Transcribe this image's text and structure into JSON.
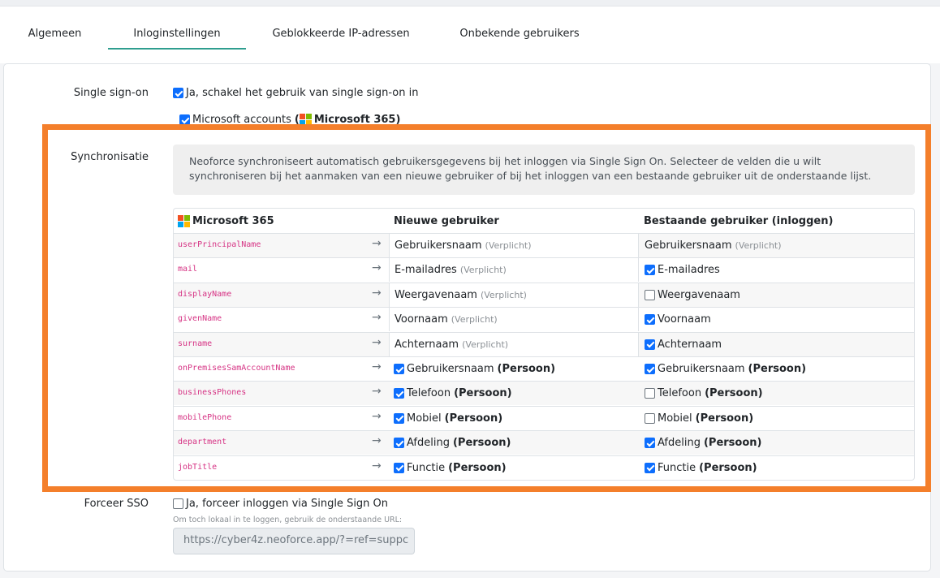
{
  "tabs": [
    {
      "label": "Algemeen",
      "active": false
    },
    {
      "label": "Inloginstellingen",
      "active": true
    },
    {
      "label": "Geblokkeerde IP-adressen",
      "active": false
    },
    {
      "label": "Onbekende gebruikers",
      "active": false
    }
  ],
  "sso": {
    "label": "Single sign-on",
    "enable_label": "Ja, schakel het gebruik van single sign-on in",
    "enabled": true,
    "microsoft_label": "Microsoft accounts",
    "microsoft_paren_open": "(",
    "microsoft_brand": "Microsoft 365",
    "microsoft_paren_close": ")",
    "microsoft_enabled": true
  },
  "sync": {
    "label": "Synchronisatie",
    "info": "Neoforce synchroniseert automatisch gebruikersgegevens bij het inloggen via Single Sign On. Selecteer de velden die u wilt synchroniseren bij het aanmaken van een nieuwe gebruiker of bij het inloggen van een bestaande gebruiker uit de onderstaande lijst.",
    "headers": {
      "source": "Microsoft 365",
      "new_user": "Nieuwe gebruiker",
      "existing_user": "Bestaande gebruiker (inloggen)"
    },
    "arrow": "→",
    "rows": [
      {
        "field": "userPrincipalName",
        "new_label": "Gebruikersnaam",
        "new_req": "(Verplicht)",
        "new_check": null,
        "new_suffix": "",
        "ex_label": "Gebruikersnaam",
        "ex_req": "(Verplicht)",
        "ex_check": null,
        "ex_suffix": ""
      },
      {
        "field": "mail",
        "new_label": "E-mailadres",
        "new_req": "(Verplicht)",
        "new_check": null,
        "new_suffix": "",
        "ex_label": "E-mailadres",
        "ex_req": "",
        "ex_check": true,
        "ex_suffix": ""
      },
      {
        "field": "displayName",
        "new_label": "Weergavenaam",
        "new_req": "(Verplicht)",
        "new_check": null,
        "new_suffix": "",
        "ex_label": "Weergavenaam",
        "ex_req": "",
        "ex_check": false,
        "ex_suffix": ""
      },
      {
        "field": "givenName",
        "new_label": "Voornaam",
        "new_req": "(Verplicht)",
        "new_check": null,
        "new_suffix": "",
        "ex_label": "Voornaam",
        "ex_req": "",
        "ex_check": true,
        "ex_suffix": ""
      },
      {
        "field": "surname",
        "new_label": "Achternaam",
        "new_req": "(Verplicht)",
        "new_check": null,
        "new_suffix": "",
        "ex_label": "Achternaam",
        "ex_req": "",
        "ex_check": true,
        "ex_suffix": ""
      },
      {
        "field": "onPremisesSamAccountName",
        "new_label": "Gebruikersnaam",
        "new_req": "",
        "new_check": true,
        "new_suffix": "(Persoon)",
        "ex_label": "Gebruikersnaam",
        "ex_req": "",
        "ex_check": true,
        "ex_suffix": "(Persoon)"
      },
      {
        "field": "businessPhones",
        "new_label": "Telefoon",
        "new_req": "",
        "new_check": true,
        "new_suffix": "(Persoon)",
        "ex_label": "Telefoon",
        "ex_req": "",
        "ex_check": false,
        "ex_suffix": "(Persoon)"
      },
      {
        "field": "mobilePhone",
        "new_label": "Mobiel",
        "new_req": "",
        "new_check": true,
        "new_suffix": "(Persoon)",
        "ex_label": "Mobiel",
        "ex_req": "",
        "ex_check": false,
        "ex_suffix": "(Persoon)"
      },
      {
        "field": "department",
        "new_label": "Afdeling",
        "new_req": "",
        "new_check": true,
        "new_suffix": "(Persoon)",
        "ex_label": "Afdeling",
        "ex_req": "",
        "ex_check": true,
        "ex_suffix": "(Persoon)"
      },
      {
        "field": "jobTitle",
        "new_label": "Functie",
        "new_req": "",
        "new_check": true,
        "new_suffix": "(Persoon)",
        "ex_label": "Functie",
        "ex_req": "",
        "ex_check": true,
        "ex_suffix": "(Persoon)"
      }
    ]
  },
  "force": {
    "label": "Forceer SSO",
    "enable_label": "Ja, forceer inloggen via Single Sign On",
    "enabled": false,
    "hint": "Om toch lokaal in te loggen, gebruik de onderstaande URL:",
    "url": "https://cyber4z.neoforce.app/?=ref=suppc"
  },
  "colors": {
    "accent": "#2f9e8f",
    "highlight": "#f47f2b",
    "checkbox": "#0d6efd",
    "field_code": "#d63384",
    "ms_red": "#f25022",
    "ms_green": "#7fba00",
    "ms_blue": "#00a4ef",
    "ms_yellow": "#ffb900"
  },
  "icons": {
    "microsoft": "microsoft-logo-icon",
    "arrow": "arrow-right-icon",
    "checkbox": "checkbox-icon"
  }
}
